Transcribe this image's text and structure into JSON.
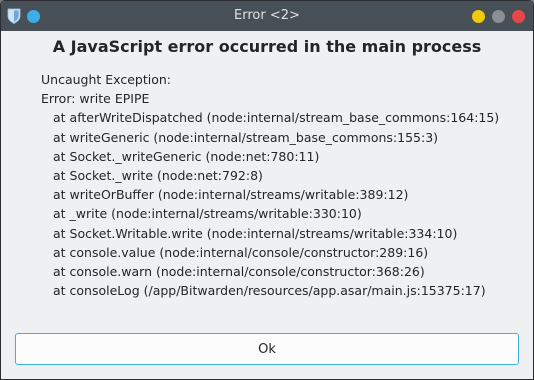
{
  "window": {
    "title": "Error <2>",
    "icons": {
      "app_icon": "shield-icon",
      "pin_icon": "blue-dot-icon",
      "minimize": "minimize-icon",
      "maximize": "maximize-icon",
      "close": "close-icon"
    },
    "colors": {
      "minimize": "#f2c811",
      "maximize": "#8a8f94",
      "close": "#e8474a",
      "accent": "#3daee9"
    }
  },
  "dialog": {
    "heading": "A JavaScript error occurred in the main process",
    "lines": [
      "Uncaught Exception:",
      "Error: write EPIPE",
      "at afterWriteDispatched (node:internal/stream_base_commons:164:15)",
      "at writeGeneric (node:internal/stream_base_commons:155:3)",
      "at Socket._writeGeneric (node:net:780:11)",
      "at Socket._write (node:net:792:8)",
      "at writeOrBuffer (node:internal/streams/writable:389:12)",
      "at _write (node:internal/streams/writable:330:10)",
      "at Socket.Writable.write (node:internal/streams/writable:334:10)",
      "at console.value (node:internal/console/constructor:289:16)",
      "at console.warn (node:internal/console/constructor:368:26)",
      "at consoleLog (/app/Bitwarden/resources/app.asar/main.js:15375:17)"
    ],
    "ok_label": "Ok"
  }
}
